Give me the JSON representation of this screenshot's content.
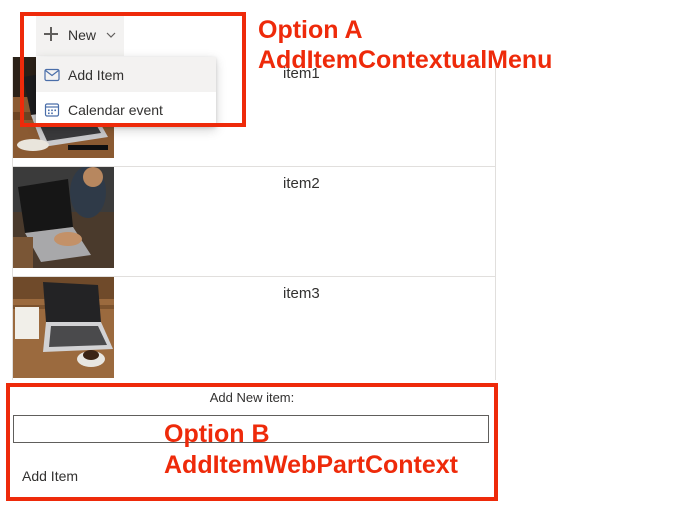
{
  "command_bar": {
    "new_label": "New",
    "icons": {
      "new": "plus-icon",
      "dropdown": "chevron-down-icon"
    }
  },
  "new_menu": {
    "items": [
      {
        "label": "Add Item",
        "icon": "mail-icon",
        "highlighted": true
      },
      {
        "label": "Calendar event",
        "icon": "calendar-icon",
        "highlighted": false
      }
    ]
  },
  "list": {
    "items": [
      {
        "title": "item1",
        "image": "laptop-desk-photo"
      },
      {
        "title": "item2",
        "image": "person-typing-laptop-photo"
      },
      {
        "title": "item3",
        "image": "laptop-coffee-photo"
      }
    ]
  },
  "add_form": {
    "label": "Add New item:",
    "input_value": "",
    "button_label": "Add Item"
  },
  "annotations": {
    "option_a": {
      "line1": "Option A",
      "line2": "AddItemContextualMenu"
    },
    "option_b": {
      "line1": "Option B",
      "line2": "AddItemWebPartContext"
    },
    "color": "#ee2a0a"
  }
}
